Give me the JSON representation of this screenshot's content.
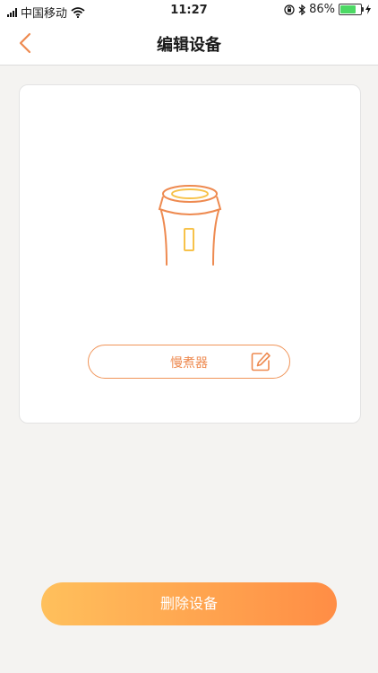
{
  "status_bar": {
    "carrier": "中国移动",
    "time": "11:27",
    "battery_percent": "86%",
    "battery_level": 0.86,
    "icons": [
      "signal-icon",
      "wifi-icon",
      "orientation-lock-icon",
      "bluetooth-icon",
      "battery-icon",
      "charging-icon"
    ]
  },
  "nav": {
    "title": "编辑设备",
    "back_icon": "chevron-left-icon"
  },
  "device": {
    "image_icon": "slow-cooker-icon",
    "name": "慢煮器",
    "edit_icon": "edit-pencil-icon"
  },
  "actions": {
    "delete_label": "删除设备"
  },
  "colors": {
    "accent": "#ee8a50",
    "gradient_start": "#ffc05c",
    "gradient_end": "#ff8d45",
    "background": "#f4f3f1"
  }
}
